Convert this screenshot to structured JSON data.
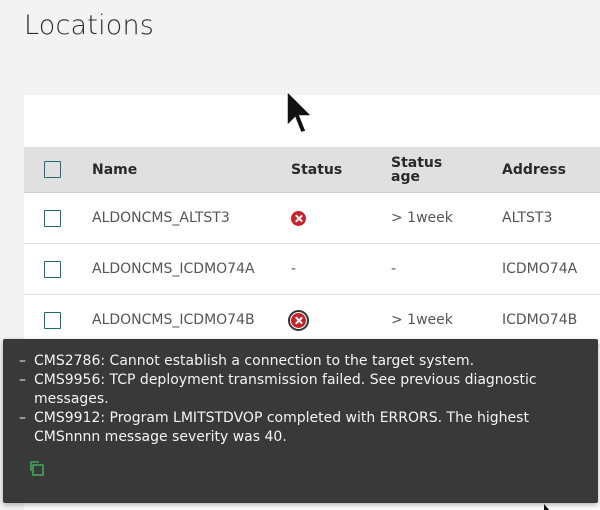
{
  "page": {
    "title": "Locations"
  },
  "table": {
    "columns": {
      "name": "Name",
      "status": "Status",
      "status_age_line1": "Status",
      "status_age_line2": "age",
      "address": "Address"
    },
    "rows": [
      {
        "name": "ALDONCMS_ALTST3",
        "status_icon": "error-icon",
        "status_age": "> 1week",
        "address": "ALTST3"
      },
      {
        "name": "ALDONCMS_ICDMO74A",
        "status_text": "-",
        "status_age": "-",
        "address": "ICDMO74A"
      },
      {
        "name": "ALDONCMS_ICDMO74B",
        "status_icon": "error-icon",
        "status_age": "> 1week",
        "address": "ICDMO74B"
      }
    ]
  },
  "tooltip": {
    "messages": [
      {
        "dash": "–",
        "text": "CMS2786: Cannot establish a connection to the target system."
      },
      {
        "dash": "–",
        "text": "CMS9956: TCP deployment transmission failed. See previous diagnostic messages."
      },
      {
        "dash": "–",
        "text": "CMS9912: Program LMITSTDVOP completed with ERRORS. The highest CMSnnnn message severity was 40."
      }
    ],
    "copy_icon": "copy-icon"
  },
  "colors": {
    "background": "#f3f3f3",
    "header_row": "#e0e0e0",
    "checkbox_border": "#1a6f78",
    "error_red": "#c8232d",
    "tooltip_bg": "#393939",
    "copy_icon_green": "#42be65"
  }
}
